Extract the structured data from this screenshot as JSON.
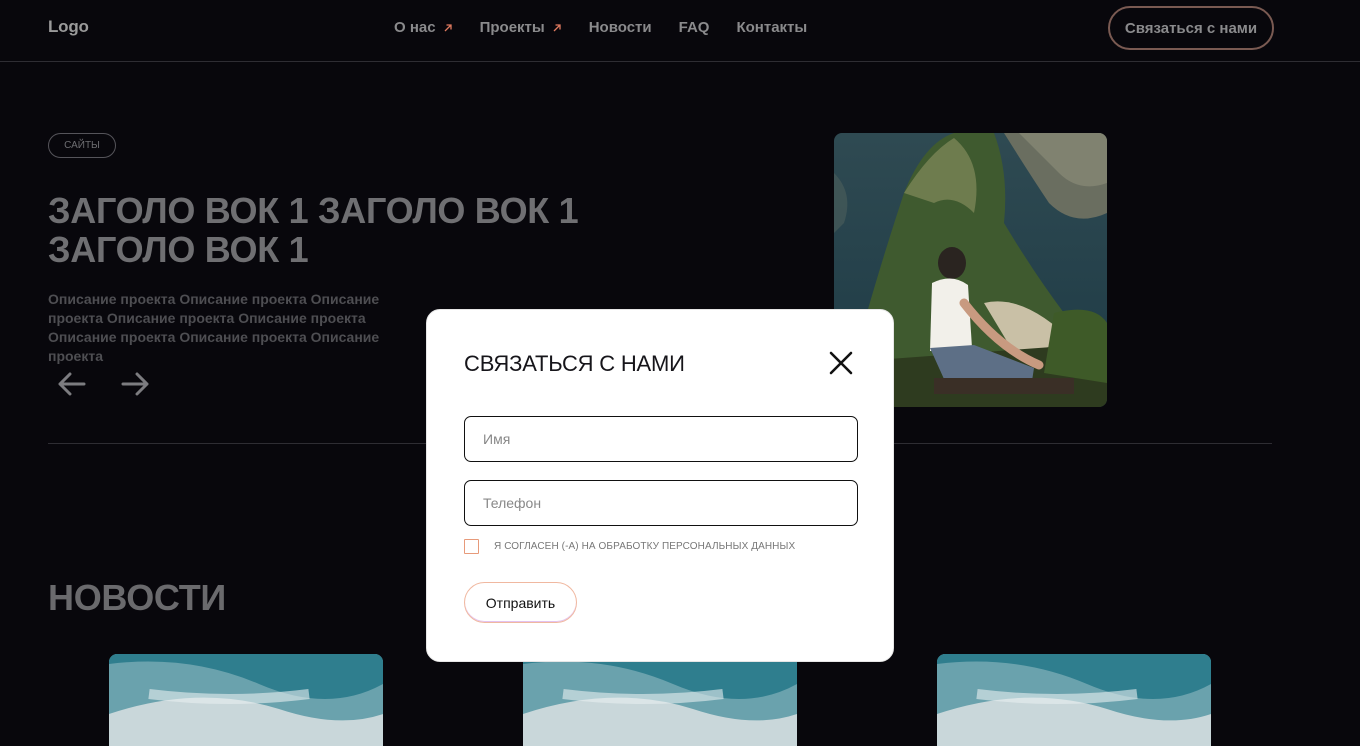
{
  "header": {
    "logo": "Logo",
    "nav": [
      {
        "label": "О нас",
        "has_arrow": true
      },
      {
        "label": "Проекты",
        "has_arrow": true
      },
      {
        "label": "Новости",
        "has_arrow": false
      },
      {
        "label": "FAQ",
        "has_arrow": false
      },
      {
        "label": "Контакты",
        "has_arrow": false
      }
    ],
    "cta_label": "Связаться с нами"
  },
  "hero": {
    "tag": "САЙТЫ",
    "title": "ЗАГОЛО ВОК 1 ЗАГОЛО ВОК 1 ЗАГОЛО ВОК 1",
    "description": "Описание проекта Описание проекта Описание проекта Описание проекта Описание проекта Описание проекта Описание проекта Описание проекта"
  },
  "news": {
    "title": "НОВОСТИ"
  },
  "modal": {
    "title": "СВЯЗАТЬСЯ С НАМИ",
    "name_placeholder": "Имя",
    "name_value": "",
    "phone_placeholder": "Телефон",
    "phone_value": "",
    "consent_label": "Я СОГЛАСЕН (-А) НА ОБРАБОТКУ ПЕРСОНАЛЬНЫХ ДАННЫХ",
    "consent_checked": false,
    "submit_label": "Отправить"
  },
  "colors": {
    "background": "#08070c",
    "nav_arrow_accent": "#e07a5f",
    "cta_border": "#7a5a52",
    "modal_background": "#ffffff",
    "checkbox_border": "#e79a7a"
  },
  "icons": {
    "nav_arrow": "arrow-up-right-icon",
    "prev": "arrow-left-icon",
    "next": "arrow-right-icon",
    "close": "close-icon"
  }
}
